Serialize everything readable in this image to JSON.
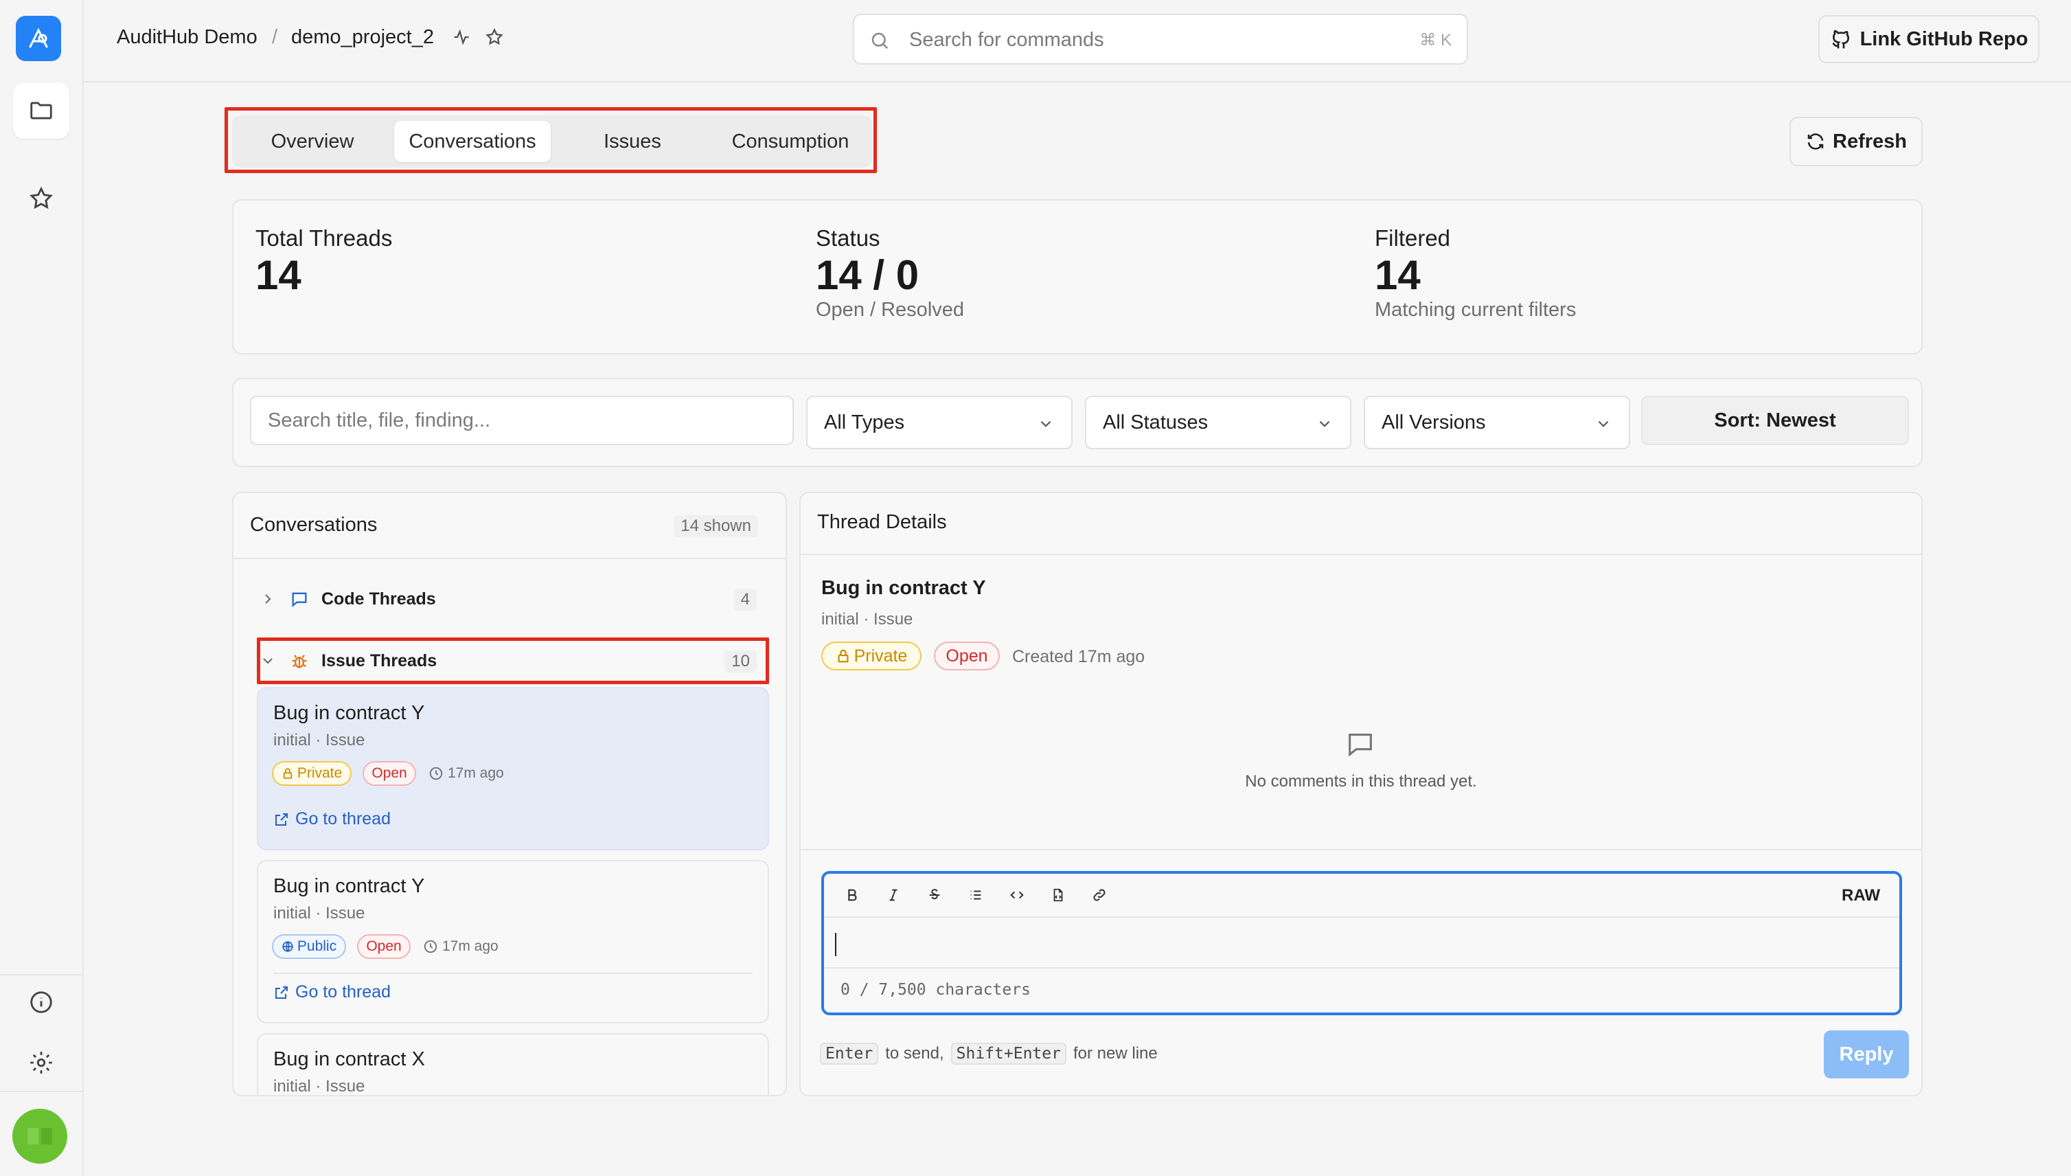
{
  "header": {
    "org": "AuditHub Demo",
    "separator": "/",
    "project": "demo_project_2",
    "search_placeholder": "Search for commands",
    "search_shortcut": "⌘ K",
    "github_button": "Link GitHub Repo"
  },
  "tabs": [
    {
      "label": "Overview",
      "active": false
    },
    {
      "label": "Conversations",
      "active": true
    },
    {
      "label": "Issues",
      "active": false
    },
    {
      "label": "Consumption",
      "active": false
    }
  ],
  "refresh_label": "Refresh",
  "stats": {
    "total": {
      "label": "Total Threads",
      "value": "14"
    },
    "status": {
      "label": "Status",
      "value": "14 / 0",
      "sub": "Open / Resolved"
    },
    "filtered": {
      "label": "Filtered",
      "value": "14",
      "sub": "Matching current filters"
    }
  },
  "filters": {
    "search_placeholder": "Search title, file, finding...",
    "types": "All Types",
    "statuses": "All Statuses",
    "versions": "All Versions",
    "sort": "Sort: Newest"
  },
  "conversations": {
    "title": "Conversations",
    "shown": "14 shown",
    "groups": [
      {
        "label": "Code Threads",
        "count": "4",
        "expanded": false
      },
      {
        "label": "Issue Threads",
        "count": "10",
        "expanded": true
      }
    ],
    "cards": [
      {
        "title": "Bug in contract Y",
        "sub": "initial · Issue",
        "visibility": "Private",
        "status": "Open",
        "time": "17m ago",
        "link": "Go to thread"
      },
      {
        "title": "Bug in contract Y",
        "sub": "initial · Issue",
        "visibility": "Public",
        "status": "Open",
        "time": "17m ago",
        "link": "Go to thread"
      },
      {
        "title": "Bug in contract X",
        "sub": "initial · Issue"
      }
    ]
  },
  "details": {
    "title": "Thread Details",
    "thread_title": "Bug in contract Y",
    "thread_sub": "initial · Issue",
    "visibility": "Private",
    "status": "Open",
    "created": "Created 17m ago",
    "empty": "No comments in this thread yet.",
    "raw_label": "RAW",
    "char_count": "0 / 7,500 characters",
    "hint_enter": "Enter",
    "hint_send": "to send,",
    "hint_shift": "Shift+Enter",
    "hint_newline": "for new line",
    "reply": "Reply"
  },
  "colors": {
    "accent": "#2383f6",
    "highlight": "#e32b1d",
    "reply_disabled": "#8cbdf7"
  }
}
